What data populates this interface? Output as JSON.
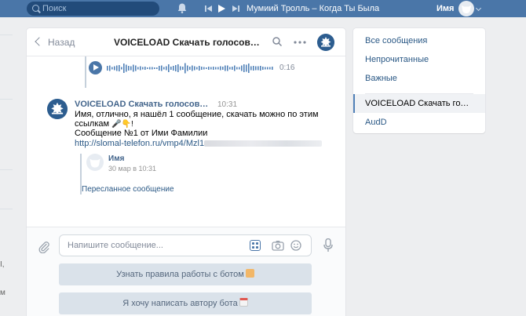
{
  "topbar": {
    "search_placeholder": "Поиск",
    "now_playing": "Мумиий Тролль – Когда Ты Была",
    "user_name": "Имя"
  },
  "left_edge": {
    "fragment_1": "I,",
    "fragment_2": "м"
  },
  "chat": {
    "back_label": "Назад",
    "title": "VOICELOAD Скачать голосовое сообщение",
    "voice_duration": "0:16",
    "message": {
      "author": "VOICELOAD Скачать голосовое сообщение",
      "time": "10:31",
      "line1": "Имя, отлично, я нашёл 1 сообщение, скачать можно по этим",
      "line2": "ссылкам",
      "line2_emoji": "🎤👇!",
      "line3": "Сообщение №1 от Ими Фамилии",
      "link": "http://slomal-telefon.ru/vmp4/Mzl1"
    },
    "forwarded": {
      "name": "Имя",
      "date": "30 мар в 10:31",
      "label": "Пересланное сообщение"
    },
    "composer": {
      "placeholder": "Напишите сообщение...",
      "bot_button_1": "Узнать правила работы с ботом",
      "bot_button_2": "Я хочу написать автору бота"
    }
  },
  "menu": {
    "items": [
      {
        "label": "Все сообщения"
      },
      {
        "label": "Непрочитанные"
      },
      {
        "label": "Важные"
      },
      {
        "label": "VOICELOAD Скачать голосовое сообщение"
      },
      {
        "label": "AudD"
      }
    ]
  },
  "colors": {
    "header": "#4a76a8",
    "link": "#2a5885",
    "page_bg": "#edeef0"
  }
}
